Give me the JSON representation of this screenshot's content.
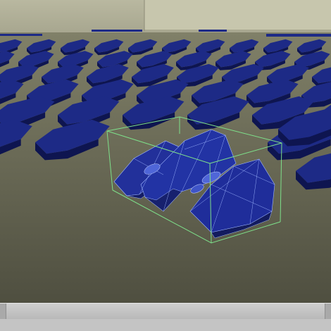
{
  "viewport": {
    "background_floor": "#5a5a4a",
    "wall_color": "#c7c6aa",
    "object_color": "#1d2a86",
    "object_shadow": "#0e1550",
    "wireframe_color": "#9fb7ff",
    "bounding_box_color": "#7ee08a",
    "selected_object": "tank-model"
  },
  "statusbar": {
    "background": "#c4c4c4"
  }
}
